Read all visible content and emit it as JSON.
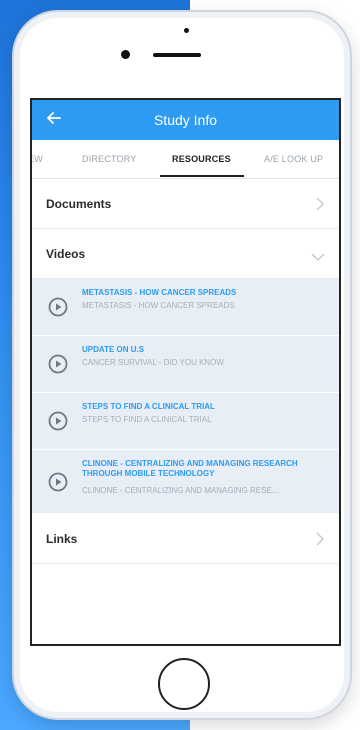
{
  "header": {
    "title": "Study Info"
  },
  "tabs": [
    {
      "label": "EW"
    },
    {
      "label": "DIRECTORY"
    },
    {
      "label": "RESOURCES"
    },
    {
      "label": "A/E LOOK UP"
    }
  ],
  "sections": {
    "documents": "Documents",
    "videos": "Videos",
    "links": "Links"
  },
  "videos": [
    {
      "title": "METASTASIS - HOW CANCER SPREADS",
      "subtitle": "METASTASIS - HOW CANCER SPREADS"
    },
    {
      "title": "UPDATE ON U.S",
      "subtitle": "CANCER SURVIVAL - DID YOU KNOW"
    },
    {
      "title": "STEPS TO FIND A CLINICAL TRIAL",
      "subtitle": "STEPS TO FIND A CLINICAL TRIAL"
    },
    {
      "title": "CLINONE - CENTRALIZING AND MANAGING RESEARCH THROUGH MOBILE TECHNOLOGY",
      "subtitle": "CLINONE - CENTRALIZING AND MANAGING RESE..."
    }
  ],
  "colors": {
    "accent": "#2d9bf2",
    "video_bg": "#e8eef6"
  },
  "icons": {
    "back": "back-arrow-icon",
    "play": "play-circle-icon",
    "chevron_right": "chevron-right-icon",
    "chevron_down": "chevron-down-icon"
  }
}
